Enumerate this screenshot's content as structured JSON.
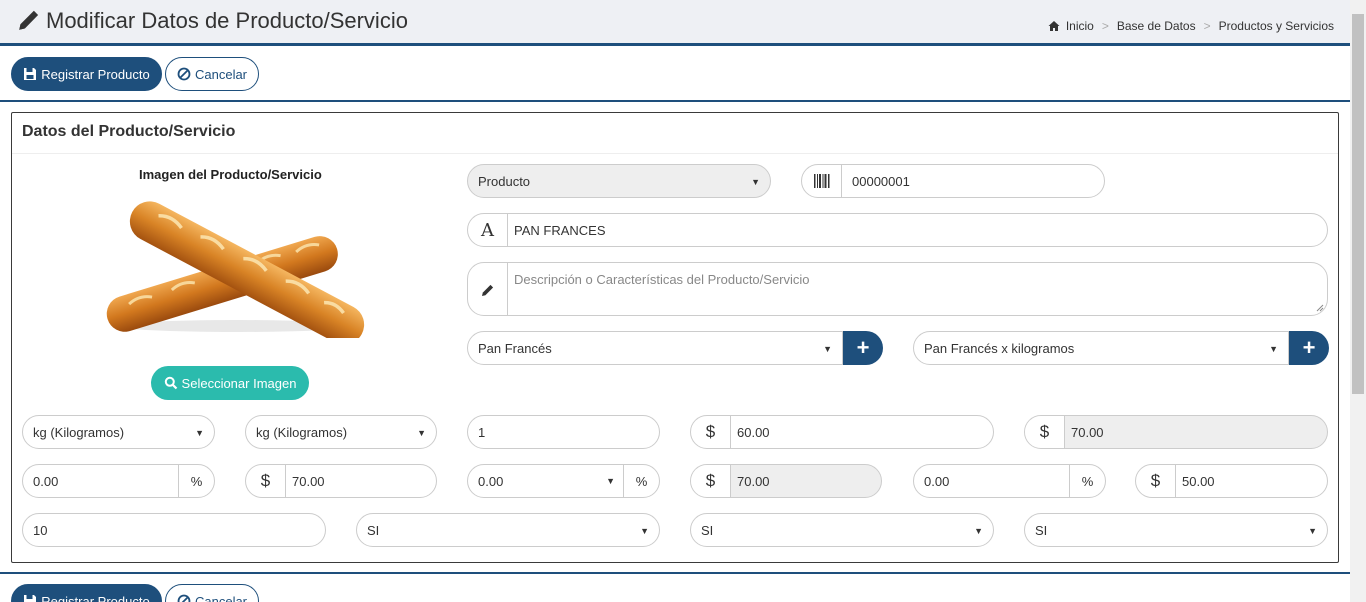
{
  "header": {
    "title": "Modificar Datos de Producto/Servicio",
    "breadcrumb": [
      "Inicio",
      "Base de Datos",
      "Productos y Servicios"
    ]
  },
  "toolbar": {
    "register_label": "Registrar Producto",
    "cancel_label": "Cancelar"
  },
  "panel": {
    "title": "Datos del Producto/Servicio",
    "image_label": "Imagen del Producto/Servicio",
    "select_image_label": "Seleccionar Imagen"
  },
  "form": {
    "tipo": "Producto",
    "codigo": "00000001",
    "nombre": "PAN FRANCES",
    "descripcion_placeholder": "Descripción o Características del Producto/Servicio",
    "categoria": "Pan Francés",
    "presentacion": "Pan Francés x kilogramos",
    "unidad_compra": "kg (Kilogramos)",
    "unidad_venta": "kg (Kilogramos)",
    "cantidad": "1",
    "precio_compra": "60.00",
    "precio_compra_total": "70.00",
    "descuento": "0.00",
    "precio_venta": "70.00",
    "impuesto": "0.00",
    "precio_final": "70.00",
    "porcentaje": "0.00",
    "precio_minimo": "50.00",
    "stock_minimo": "10",
    "opcion1": "SI",
    "opcion2": "SI",
    "opcion3": "SI",
    "currency_symbol": "$",
    "percent_symbol": "%",
    "letter_a": "A"
  },
  "colors": {
    "primary": "#1e4f7c",
    "teal": "#2bbbad"
  }
}
